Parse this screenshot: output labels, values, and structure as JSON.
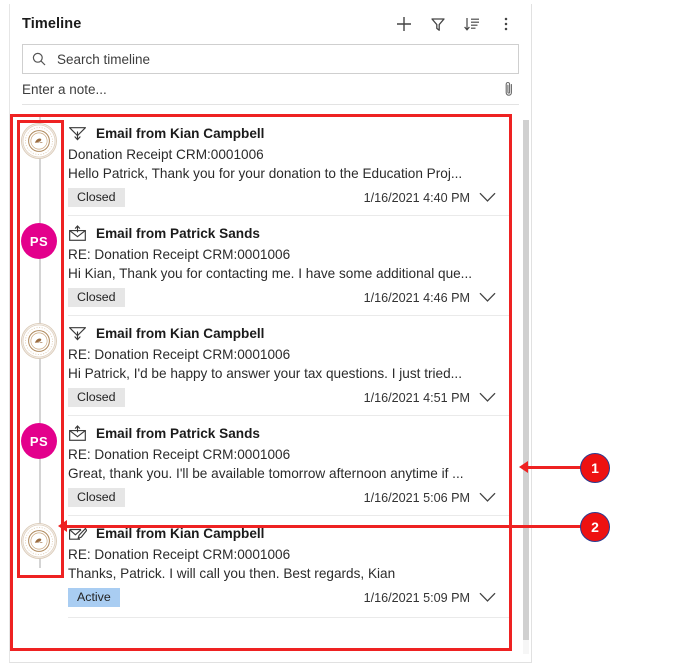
{
  "panel": {
    "title": "Timeline",
    "header_actions": [
      {
        "name": "add-icon",
        "label": "Add"
      },
      {
        "name": "filter-icon",
        "label": "Filter"
      },
      {
        "name": "sort-icon",
        "label": "Sort"
      },
      {
        "name": "more-icon",
        "label": "More commands"
      }
    ],
    "search": {
      "placeholder": "Search timeline",
      "value": "",
      "icon": "search-icon"
    },
    "note": {
      "placeholder": "Enter a note...",
      "attach_icon": "paperclip-icon"
    }
  },
  "colors": {
    "accent_pink": "#e3008c",
    "badge_closed_bg": "#e6e6e6",
    "badge_active_bg": "#a9cdf2",
    "annotation_red": "#ee2222",
    "rail_line": "#d4d4d4"
  },
  "timeline": {
    "items": [
      {
        "avatar": {
          "type": "logo",
          "name": "org-logo-avatar",
          "initials": ""
        },
        "icon": "email-outgoing-icon",
        "title": "Email from Kian Campbell",
        "subject": "Donation Receipt CRM:0001006",
        "preview": "Hello Patrick,   Thank you for your donation to the Education Proj...",
        "status": "Closed",
        "status_kind": "closed",
        "timestamp": "1/16/2021 4:40 PM",
        "expand_icon": "chevron-down-icon"
      },
      {
        "avatar": {
          "type": "initials",
          "name": "patrick-sands-avatar",
          "initials": "PS"
        },
        "icon": "email-incoming-icon",
        "title": "Email from Patrick Sands",
        "subject": "RE: Donation Receipt CRM:0001006",
        "preview": "Hi Kian, Thank you for contacting me. I have some additional que...",
        "status": "Closed",
        "status_kind": "closed",
        "timestamp": "1/16/2021 4:46 PM",
        "expand_icon": "chevron-down-icon"
      },
      {
        "avatar": {
          "type": "logo",
          "name": "org-logo-avatar",
          "initials": ""
        },
        "icon": "email-outgoing-icon",
        "title": "Email from Kian Campbell",
        "subject": "RE: Donation Receipt CRM:0001006",
        "preview": "Hi Patrick,   I'd be happy to answer your tax questions. I just tried...",
        "status": "Closed",
        "status_kind": "closed",
        "timestamp": "1/16/2021 4:51 PM",
        "expand_icon": "chevron-down-icon"
      },
      {
        "avatar": {
          "type": "initials",
          "name": "patrick-sands-avatar",
          "initials": "PS"
        },
        "icon": "email-incoming-icon",
        "title": "Email from Patrick Sands",
        "subject": "RE: Donation Receipt CRM:0001006",
        "preview": "Great, thank you. I'll be available tomorrow afternoon anytime if ...",
        "status": "Closed",
        "status_kind": "closed",
        "timestamp": "1/16/2021 5:06 PM",
        "expand_icon": "chevron-down-icon"
      },
      {
        "avatar": {
          "type": "logo",
          "name": "org-logo-avatar",
          "initials": ""
        },
        "icon": "email-draft-icon",
        "title": "Email from Kian Campbell",
        "subject": "RE: Donation Receipt CRM:0001006",
        "preview": "Thanks, Patrick. I will call you then.   Best regards, Kian",
        "status": "Active",
        "status_kind": "active",
        "timestamp": "1/16/2021 5:09 PM",
        "expand_icon": "chevron-down-icon"
      }
    ]
  },
  "annotations": {
    "markers": [
      {
        "number": "1",
        "target": "timeline-records-region"
      },
      {
        "number": "2",
        "target": "timeline-rail-region"
      }
    ]
  }
}
